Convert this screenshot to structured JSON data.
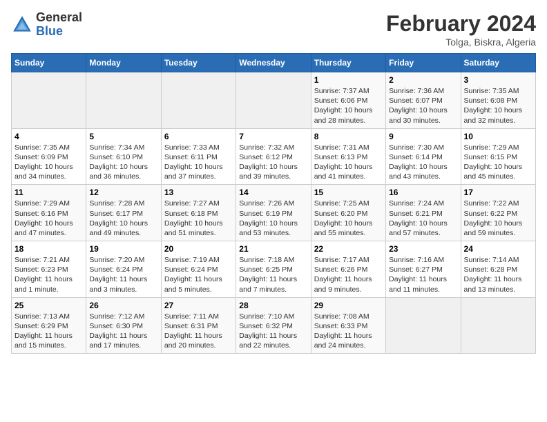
{
  "header": {
    "logo_general": "General",
    "logo_blue": "Blue",
    "month_year": "February 2024",
    "location": "Tolga, Biskra, Algeria"
  },
  "days_of_week": [
    "Sunday",
    "Monday",
    "Tuesday",
    "Wednesday",
    "Thursday",
    "Friday",
    "Saturday"
  ],
  "weeks": [
    [
      {
        "day": "",
        "info": ""
      },
      {
        "day": "",
        "info": ""
      },
      {
        "day": "",
        "info": ""
      },
      {
        "day": "",
        "info": ""
      },
      {
        "day": "1",
        "info": "Sunrise: 7:37 AM\nSunset: 6:06 PM\nDaylight: 10 hours and 28 minutes."
      },
      {
        "day": "2",
        "info": "Sunrise: 7:36 AM\nSunset: 6:07 PM\nDaylight: 10 hours and 30 minutes."
      },
      {
        "day": "3",
        "info": "Sunrise: 7:35 AM\nSunset: 6:08 PM\nDaylight: 10 hours and 32 minutes."
      }
    ],
    [
      {
        "day": "4",
        "info": "Sunrise: 7:35 AM\nSunset: 6:09 PM\nDaylight: 10 hours and 34 minutes."
      },
      {
        "day": "5",
        "info": "Sunrise: 7:34 AM\nSunset: 6:10 PM\nDaylight: 10 hours and 36 minutes."
      },
      {
        "day": "6",
        "info": "Sunrise: 7:33 AM\nSunset: 6:11 PM\nDaylight: 10 hours and 37 minutes."
      },
      {
        "day": "7",
        "info": "Sunrise: 7:32 AM\nSunset: 6:12 PM\nDaylight: 10 hours and 39 minutes."
      },
      {
        "day": "8",
        "info": "Sunrise: 7:31 AM\nSunset: 6:13 PM\nDaylight: 10 hours and 41 minutes."
      },
      {
        "day": "9",
        "info": "Sunrise: 7:30 AM\nSunset: 6:14 PM\nDaylight: 10 hours and 43 minutes."
      },
      {
        "day": "10",
        "info": "Sunrise: 7:29 AM\nSunset: 6:15 PM\nDaylight: 10 hours and 45 minutes."
      }
    ],
    [
      {
        "day": "11",
        "info": "Sunrise: 7:29 AM\nSunset: 6:16 PM\nDaylight: 10 hours and 47 minutes."
      },
      {
        "day": "12",
        "info": "Sunrise: 7:28 AM\nSunset: 6:17 PM\nDaylight: 10 hours and 49 minutes."
      },
      {
        "day": "13",
        "info": "Sunrise: 7:27 AM\nSunset: 6:18 PM\nDaylight: 10 hours and 51 minutes."
      },
      {
        "day": "14",
        "info": "Sunrise: 7:26 AM\nSunset: 6:19 PM\nDaylight: 10 hours and 53 minutes."
      },
      {
        "day": "15",
        "info": "Sunrise: 7:25 AM\nSunset: 6:20 PM\nDaylight: 10 hours and 55 minutes."
      },
      {
        "day": "16",
        "info": "Sunrise: 7:24 AM\nSunset: 6:21 PM\nDaylight: 10 hours and 57 minutes."
      },
      {
        "day": "17",
        "info": "Sunrise: 7:22 AM\nSunset: 6:22 PM\nDaylight: 10 hours and 59 minutes."
      }
    ],
    [
      {
        "day": "18",
        "info": "Sunrise: 7:21 AM\nSunset: 6:23 PM\nDaylight: 11 hours and 1 minute."
      },
      {
        "day": "19",
        "info": "Sunrise: 7:20 AM\nSunset: 6:24 PM\nDaylight: 11 hours and 3 minutes."
      },
      {
        "day": "20",
        "info": "Sunrise: 7:19 AM\nSunset: 6:24 PM\nDaylight: 11 hours and 5 minutes."
      },
      {
        "day": "21",
        "info": "Sunrise: 7:18 AM\nSunset: 6:25 PM\nDaylight: 11 hours and 7 minutes."
      },
      {
        "day": "22",
        "info": "Sunrise: 7:17 AM\nSunset: 6:26 PM\nDaylight: 11 hours and 9 minutes."
      },
      {
        "day": "23",
        "info": "Sunrise: 7:16 AM\nSunset: 6:27 PM\nDaylight: 11 hours and 11 minutes."
      },
      {
        "day": "24",
        "info": "Sunrise: 7:14 AM\nSunset: 6:28 PM\nDaylight: 11 hours and 13 minutes."
      }
    ],
    [
      {
        "day": "25",
        "info": "Sunrise: 7:13 AM\nSunset: 6:29 PM\nDaylight: 11 hours and 15 minutes."
      },
      {
        "day": "26",
        "info": "Sunrise: 7:12 AM\nSunset: 6:30 PM\nDaylight: 11 hours and 17 minutes."
      },
      {
        "day": "27",
        "info": "Sunrise: 7:11 AM\nSunset: 6:31 PM\nDaylight: 11 hours and 20 minutes."
      },
      {
        "day": "28",
        "info": "Sunrise: 7:10 AM\nSunset: 6:32 PM\nDaylight: 11 hours and 22 minutes."
      },
      {
        "day": "29",
        "info": "Sunrise: 7:08 AM\nSunset: 6:33 PM\nDaylight: 11 hours and 24 minutes."
      },
      {
        "day": "",
        "info": ""
      },
      {
        "day": "",
        "info": ""
      }
    ]
  ]
}
